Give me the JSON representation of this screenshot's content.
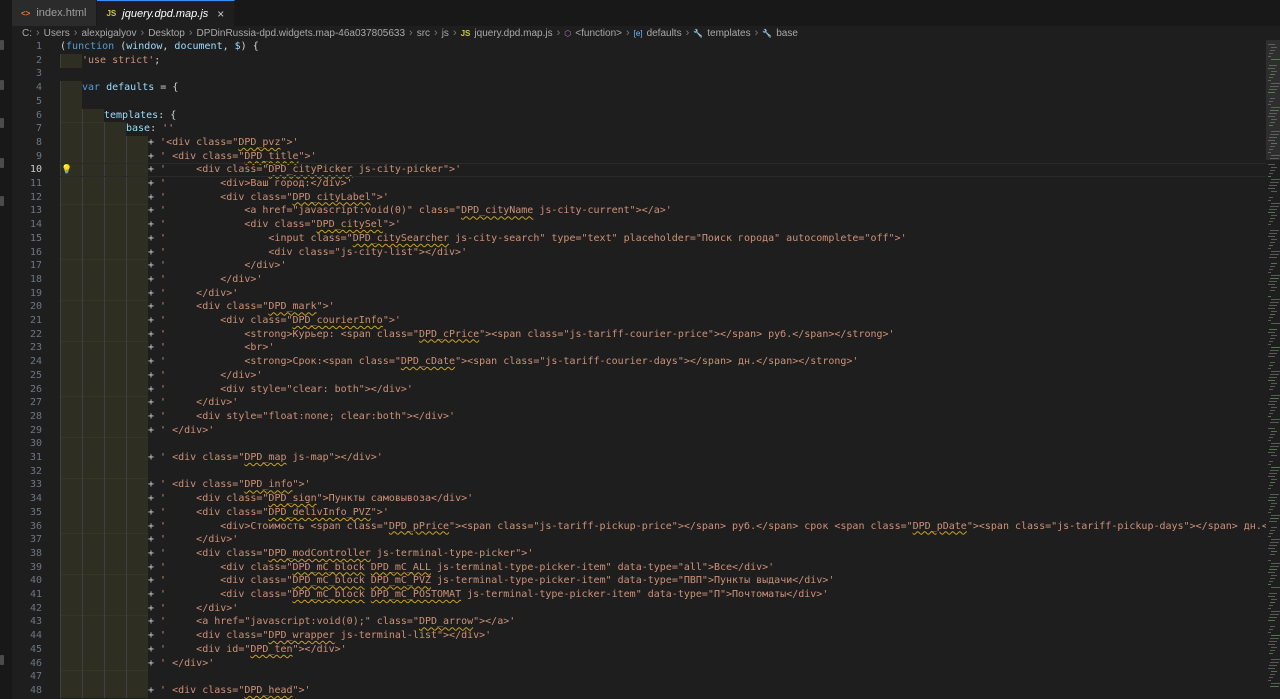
{
  "tabs": [
    {
      "label": "index.html",
      "icon": "html-file-icon",
      "icon_glyph": "<>",
      "active": false
    },
    {
      "label": "jquery.dpd.map.js",
      "icon": "js-file-icon",
      "icon_glyph": "JS",
      "active": true,
      "close_glyph": "×"
    }
  ],
  "breadcrumb": [
    {
      "label": "C:"
    },
    {
      "label": "Users"
    },
    {
      "label": "alexpigalyov"
    },
    {
      "label": "Desktop"
    },
    {
      "label": "DPDinRussia-dpd.widgets.map-46a037805633"
    },
    {
      "label": "src"
    },
    {
      "label": "js"
    },
    {
      "label": "jquery.dpd.map.js",
      "icon": "js-file-icon",
      "icon_glyph": "JS"
    },
    {
      "label": "<function>",
      "icon": "function-icon",
      "icon_glyph": "⬡"
    },
    {
      "label": "defaults",
      "icon": "variable-icon",
      "icon_glyph": "[e]"
    },
    {
      "label": "templates",
      "icon": "wrench-icon",
      "icon_glyph": "🔧"
    },
    {
      "label": "base",
      "icon": "wrench-icon",
      "icon_glyph": "🔧"
    }
  ],
  "editor": {
    "current_line": 10,
    "lines": [
      {
        "n": "1",
        "i": 0,
        "t": [
          [
            "p",
            "("
          ],
          [
            "k",
            "function"
          ],
          [
            "p",
            " ("
          ],
          [
            "v",
            "window"
          ],
          [
            "p",
            ", "
          ],
          [
            "v",
            "document"
          ],
          [
            "p",
            ", "
          ],
          [
            "v",
            "$"
          ],
          [
            "p",
            ") {"
          ]
        ]
      },
      {
        "n": "2",
        "i": 1,
        "t": [
          [
            "s",
            "'use strict'"
          ],
          [
            "p",
            ";"
          ]
        ]
      },
      {
        "n": "3",
        "i": 0,
        "t": []
      },
      {
        "n": "4",
        "i": 1,
        "t": [
          [
            "k",
            "var"
          ],
          [
            "p",
            " "
          ],
          [
            "v",
            "defaults"
          ],
          [
            "p",
            " = {"
          ]
        ]
      },
      {
        "n": "5",
        "i": 1,
        "t": []
      },
      {
        "n": "6",
        "i": 2,
        "t": [
          [
            "v",
            "templates"
          ],
          [
            "p",
            ": "
          ],
          [
            "p",
            "{"
          ]
        ]
      },
      {
        "n": "7",
        "i": 3,
        "t": [
          [
            "v",
            "base"
          ],
          [
            "p",
            ": "
          ],
          [
            "s",
            "''"
          ]
        ]
      },
      {
        "n": "8",
        "i": 4,
        "t": [
          [
            "p",
            "+ "
          ],
          [
            "s",
            "'<div class=\""
          ],
          [
            "s",
            "DPD_pvz",
            "sq"
          ],
          [
            "s",
            "\">'"
          ]
        ]
      },
      {
        "n": "9",
        "i": 4,
        "t": [
          [
            "p",
            "+ "
          ],
          [
            "s",
            "' <div class=\""
          ],
          [
            "s",
            "DPD_title",
            "sq"
          ],
          [
            "s",
            "\">'"
          ]
        ]
      },
      {
        "n": "10",
        "i": 4,
        "bulb": true,
        "t": [
          [
            "p",
            "+ "
          ],
          [
            "s",
            "'     <div class=\""
          ],
          [
            "s",
            "DPD_cityPicker",
            "sq"
          ],
          [
            "s",
            " js-city-picker\">'"
          ]
        ]
      },
      {
        "n": "11",
        "i": 4,
        "t": [
          [
            "p",
            "+ "
          ],
          [
            "s",
            "'         <div>Ваш город:</div>'"
          ]
        ]
      },
      {
        "n": "12",
        "i": 4,
        "t": [
          [
            "p",
            "+ "
          ],
          [
            "s",
            "'         <div class=\""
          ],
          [
            "s",
            "DPD_cityLabel",
            "sq"
          ],
          [
            "s",
            "\">'"
          ]
        ]
      },
      {
        "n": "13",
        "i": 4,
        "t": [
          [
            "p",
            "+ "
          ],
          [
            "s",
            "'             <a href=\"javascript:void(0)\" class=\""
          ],
          [
            "s",
            "DPD_cityName",
            "sq"
          ],
          [
            "s",
            " js-city-current\"></a>'"
          ]
        ]
      },
      {
        "n": "14",
        "i": 4,
        "t": [
          [
            "p",
            "+ "
          ],
          [
            "s",
            "'             <div class=\""
          ],
          [
            "s",
            "DPD_citySel",
            "sq"
          ],
          [
            "s",
            "\">'"
          ]
        ]
      },
      {
        "n": "15",
        "i": 4,
        "t": [
          [
            "p",
            "+ "
          ],
          [
            "s",
            "'                 <input class=\""
          ],
          [
            "s",
            "DPD_citySearcher",
            "sq"
          ],
          [
            "s",
            " js-city-search\" type=\"text\" placeholder=\"Поиск города\" autocomplete=\"off\">'"
          ]
        ]
      },
      {
        "n": "16",
        "i": 4,
        "t": [
          [
            "p",
            "+ "
          ],
          [
            "s",
            "'                 <div class=\"js-city-list\"></div>'"
          ]
        ]
      },
      {
        "n": "17",
        "i": 4,
        "t": [
          [
            "p",
            "+ "
          ],
          [
            "s",
            "'             </div>'"
          ]
        ]
      },
      {
        "n": "18",
        "i": 4,
        "t": [
          [
            "p",
            "+ "
          ],
          [
            "s",
            "'         </div>'"
          ]
        ]
      },
      {
        "n": "19",
        "i": 4,
        "t": [
          [
            "p",
            "+ "
          ],
          [
            "s",
            "'     </div>'"
          ]
        ]
      },
      {
        "n": "20",
        "i": 4,
        "t": [
          [
            "p",
            "+ "
          ],
          [
            "s",
            "'     <div class=\""
          ],
          [
            "s",
            "DPD_mark",
            "sq"
          ],
          [
            "s",
            "\">'"
          ]
        ]
      },
      {
        "n": "21",
        "i": 4,
        "t": [
          [
            "p",
            "+ "
          ],
          [
            "s",
            "'         <div class=\""
          ],
          [
            "s",
            "DPD_courierInfo",
            "sq"
          ],
          [
            "s",
            "\">'"
          ]
        ]
      },
      {
        "n": "22",
        "i": 4,
        "t": [
          [
            "p",
            "+ "
          ],
          [
            "s",
            "'             <strong>Курьер: <span class=\""
          ],
          [
            "s",
            "DPD_cPrice",
            "sq"
          ],
          [
            "s",
            "\"><span class=\"js-tariff-courier-price\"></span> руб.</span></strong>'"
          ]
        ]
      },
      {
        "n": "23",
        "i": 4,
        "t": [
          [
            "p",
            "+ "
          ],
          [
            "s",
            "'             <br>'"
          ]
        ]
      },
      {
        "n": "24",
        "i": 4,
        "t": [
          [
            "p",
            "+ "
          ],
          [
            "s",
            "'             <strong>Срок:<span class=\""
          ],
          [
            "s",
            "DPD_cDate",
            "sq"
          ],
          [
            "s",
            "\"><span class=\"js-tariff-courier-days\"></span> дн.</span></strong>'"
          ]
        ]
      },
      {
        "n": "25",
        "i": 4,
        "t": [
          [
            "p",
            "+ "
          ],
          [
            "s",
            "'         </div>'"
          ]
        ]
      },
      {
        "n": "26",
        "i": 4,
        "t": [
          [
            "p",
            "+ "
          ],
          [
            "s",
            "'         <div style=\"clear: both\"></div>'"
          ]
        ]
      },
      {
        "n": "27",
        "i": 4,
        "t": [
          [
            "p",
            "+ "
          ],
          [
            "s",
            "'     </div>'"
          ]
        ]
      },
      {
        "n": "28",
        "i": 4,
        "t": [
          [
            "p",
            "+ "
          ],
          [
            "s",
            "'     <div style=\"float:none; clear:both\"></div>'"
          ]
        ]
      },
      {
        "n": "29",
        "i": 4,
        "t": [
          [
            "p",
            "+ "
          ],
          [
            "s",
            "' </div>'"
          ]
        ]
      },
      {
        "n": "30",
        "i": 4,
        "t": []
      },
      {
        "n": "31",
        "i": 4,
        "t": [
          [
            "p",
            "+ "
          ],
          [
            "s",
            "' <div class=\""
          ],
          [
            "s",
            "DPD_map",
            "sq"
          ],
          [
            "s",
            " js-map\"></div>'"
          ]
        ]
      },
      {
        "n": "32",
        "i": 4,
        "t": []
      },
      {
        "n": "33",
        "i": 4,
        "t": [
          [
            "p",
            "+ "
          ],
          [
            "s",
            "' <div class=\""
          ],
          [
            "s",
            "DPD_info",
            "sq"
          ],
          [
            "s",
            "\">'"
          ]
        ]
      },
      {
        "n": "34",
        "i": 4,
        "t": [
          [
            "p",
            "+ "
          ],
          [
            "s",
            "'     <div class=\""
          ],
          [
            "s",
            "DPD_sign",
            "sq"
          ],
          [
            "s",
            "\">Пункты самовывоза</div>'"
          ]
        ]
      },
      {
        "n": "35",
        "i": 4,
        "t": [
          [
            "p",
            "+ "
          ],
          [
            "s",
            "'     <div class=\""
          ],
          [
            "s",
            "DPD_delivInfo_PVZ",
            "sq"
          ],
          [
            "s",
            "\">'"
          ]
        ]
      },
      {
        "n": "36",
        "i": 4,
        "t": [
          [
            "p",
            "+ "
          ],
          [
            "s",
            "'         <div>Стоимость <span class=\""
          ],
          [
            "s",
            "DPD_pPrice",
            "sq"
          ],
          [
            "s",
            "\"><span class=\"js-tariff-pickup-price\"></span> руб.</span> срок <span class=\""
          ],
          [
            "s",
            "DPD_pDate",
            "sq"
          ],
          [
            "s",
            "\"><span class=\"js-tariff-pickup-days\"></span> дн.</span></div>'"
          ]
        ]
      },
      {
        "n": "37",
        "i": 4,
        "t": [
          [
            "p",
            "+ "
          ],
          [
            "s",
            "'     </div>'"
          ]
        ]
      },
      {
        "n": "38",
        "i": 4,
        "t": [
          [
            "p",
            "+ "
          ],
          [
            "s",
            "'     <div class=\""
          ],
          [
            "s",
            "DPD_modController",
            "sq"
          ],
          [
            "s",
            " js-terminal-type-picker\">'"
          ]
        ]
      },
      {
        "n": "39",
        "i": 4,
        "t": [
          [
            "p",
            "+ "
          ],
          [
            "s",
            "'         <div class=\""
          ],
          [
            "s",
            "DPD_mC_block",
            "sq"
          ],
          [
            "s",
            " "
          ],
          [
            "s",
            "DPD_mC_ALL",
            "sq"
          ],
          [
            "s",
            " js-terminal-type-picker-item\" data-type=\"all\">Все</div>'"
          ]
        ]
      },
      {
        "n": "40",
        "i": 4,
        "t": [
          [
            "p",
            "+ "
          ],
          [
            "s",
            "'         <div class=\""
          ],
          [
            "s",
            "DPD_mC_block",
            "sq"
          ],
          [
            "s",
            " "
          ],
          [
            "s",
            "DPD_mC_PVZ",
            "sq"
          ],
          [
            "s",
            " js-terminal-type-picker-item\" data-type=\"ПВП\">Пункты выдачи</div>'"
          ]
        ]
      },
      {
        "n": "41",
        "i": 4,
        "t": [
          [
            "p",
            "+ "
          ],
          [
            "s",
            "'         <div class=\""
          ],
          [
            "s",
            "DPD_mC_block",
            "sq"
          ],
          [
            "s",
            " "
          ],
          [
            "s",
            "DPD_mC_POSTOMAT",
            "sq"
          ],
          [
            "s",
            " js-terminal-type-picker-item\" data-type=\"П\">Почтоматы</div>'"
          ]
        ]
      },
      {
        "n": "42",
        "i": 4,
        "t": [
          [
            "p",
            "+ "
          ],
          [
            "s",
            "'     </div>'"
          ]
        ]
      },
      {
        "n": "43",
        "i": 4,
        "t": [
          [
            "p",
            "+ "
          ],
          [
            "s",
            "'     <a href=\"javascript:void(0);\" class=\""
          ],
          [
            "s",
            "DPD_arrow",
            "sq"
          ],
          [
            "s",
            "\"></a>'"
          ]
        ]
      },
      {
        "n": "44",
        "i": 4,
        "t": [
          [
            "p",
            "+ "
          ],
          [
            "s",
            "'     <div class=\""
          ],
          [
            "s",
            "DPD_wrapper",
            "sq"
          ],
          [
            "s",
            " js-terminal-list\"></div>'"
          ]
        ]
      },
      {
        "n": "45",
        "i": 4,
        "t": [
          [
            "p",
            "+ "
          ],
          [
            "s",
            "'     <div id=\""
          ],
          [
            "s",
            "DPD_ten",
            "sq"
          ],
          [
            "s",
            "\"></div>'"
          ]
        ]
      },
      {
        "n": "46",
        "i": 4,
        "t": [
          [
            "p",
            "+ "
          ],
          [
            "s",
            "' </div>'"
          ]
        ]
      },
      {
        "n": "47",
        "i": 4,
        "t": []
      },
      {
        "n": "48",
        "i": 4,
        "t": [
          [
            "p",
            "+ "
          ],
          [
            "s",
            "' <div class=\""
          ],
          [
            "s",
            "DPD_head",
            "sq"
          ],
          [
            "s",
            "\">'"
          ]
        ]
      }
    ]
  }
}
